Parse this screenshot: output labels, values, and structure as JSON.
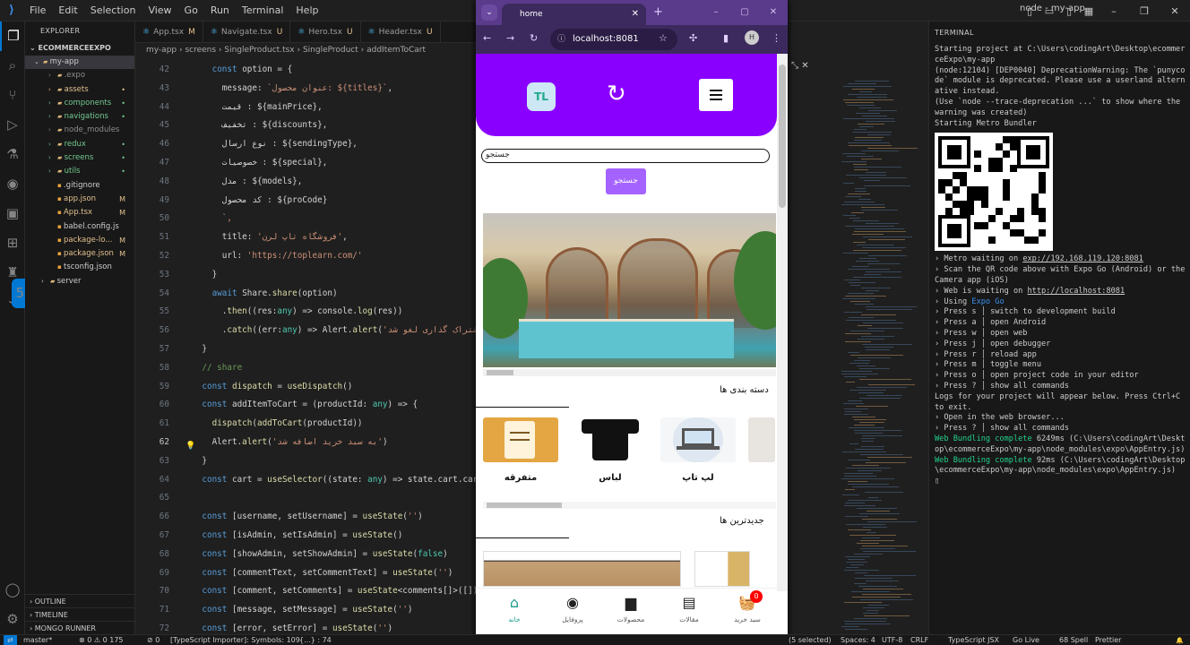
{
  "titlebar": {
    "menu": [
      "File",
      "Edit",
      "Selection",
      "View",
      "Go",
      "Run",
      "Terminal",
      "Help"
    ],
    "window_title": "node - my-app"
  },
  "explorer": {
    "header": "EXPLORER",
    "root": "ECOMMERCEEXPO",
    "items": [
      {
        "name": "my-app",
        "kind": "folder-open",
        "status": "",
        "color": "dir"
      },
      {
        "name": ".expo",
        "kind": "folder",
        "status": "",
        "color": "gr"
      },
      {
        "name": "assets",
        "kind": "folder",
        "status": "•",
        "color": "m"
      },
      {
        "name": "components",
        "kind": "folder",
        "status": "•",
        "color": "g"
      },
      {
        "name": "navigations",
        "kind": "folder",
        "status": "•",
        "color": "g"
      },
      {
        "name": "node_modules",
        "kind": "folder",
        "status": "",
        "color": "gr"
      },
      {
        "name": "redux",
        "kind": "folder",
        "status": "•",
        "color": "g"
      },
      {
        "name": "screens",
        "kind": "folder",
        "status": "•",
        "color": "g"
      },
      {
        "name": "utils",
        "kind": "folder",
        "status": "•",
        "color": "g"
      },
      {
        "name": ".gitignore",
        "kind": "file",
        "status": "",
        "color": "dir"
      },
      {
        "name": "app.json",
        "kind": "file",
        "status": "M",
        "color": "m"
      },
      {
        "name": "App.tsx",
        "kind": "file",
        "status": "M",
        "color": "m"
      },
      {
        "name": "babel.config.js",
        "kind": "file",
        "status": "",
        "color": "dir"
      },
      {
        "name": "package-lo...",
        "kind": "file",
        "status": "M",
        "color": "m"
      },
      {
        "name": "package.json",
        "kind": "file",
        "status": "M",
        "color": "m"
      },
      {
        "name": "tsconfig.json",
        "kind": "file",
        "status": "",
        "color": "dir"
      },
      {
        "name": "server",
        "kind": "folder",
        "status": "",
        "color": "dir"
      }
    ],
    "bottom": [
      "OUTLINE",
      "TIMELINE",
      "MONGO RUNNER"
    ]
  },
  "editor": {
    "tabs": [
      {
        "label": "App.tsx",
        "mod": "M"
      },
      {
        "label": "Navigate.tsx",
        "mod": "U"
      },
      {
        "label": "Hero.tsx",
        "mod": "U"
      },
      {
        "label": "Header.tsx",
        "mod": "U"
      }
    ],
    "breadcrumb": "my-app  ›  screens  ›  SingleProduct.tsx  ›  SingleProduct  ›  addItemToCart",
    "lines": [
      {
        "n": "42",
        "text": "      const option = {"
      },
      {
        "n": "43",
        "text": "        message: `عنوان محصول: ${titles}`,"
      },
      {
        "n": "44",
        "text": "        قیمت : ${mainPrice},"
      },
      {
        "n": "45",
        "text": "        تخفیف : ${discounts},"
      },
      {
        "n": "46",
        "text": "        نوع ارسال : ${sendingType},"
      },
      {
        "n": "47",
        "text": "        خصوصیات : ${special},"
      },
      {
        "n": "48",
        "text": "        مدل : ${models},"
      },
      {
        "n": "49",
        "text": "        کد محصول : ${proCode}"
      },
      {
        "n": "50",
        "text": "        `,"
      },
      {
        "n": "51",
        "text": "        title: 'فروشگاه تاپ لرن',"
      },
      {
        "n": "52",
        "text": "        url: 'https://toplearn.com/'"
      },
      {
        "n": "53",
        "text": "      }"
      },
      {
        "n": "54",
        "text": "      await Share.share(option)"
      },
      {
        "n": "55",
        "text": "        .then((res:any) => console.log(res))"
      },
      {
        "n": "56",
        "text": "        .catch((err:any) => Alert.alert('اشتراک گذاری لغو شد'))"
      },
      {
        "n": "57",
        "text": "    }"
      },
      {
        "n": "58",
        "text": "    // share"
      },
      {
        "n": "59",
        "text": "    const dispatch = useDispatch()"
      },
      {
        "n": "60",
        "text": "    const addItemToCart = (productId: any) => {"
      },
      {
        "n": "61",
        "text": "      dispatch(addToCart(productId))"
      },
      {
        "n": "62",
        "text": "      Alert.alert('به سبد خرید اضافه شد')"
      },
      {
        "n": "63",
        "text": "    }"
      },
      {
        "n": "64",
        "text": "    const cart = useSelector((state: any) => state.cart.cart)"
      },
      {
        "n": "65",
        "text": ""
      },
      {
        "n": "66",
        "text": "    const [username, setUsername] = useState('')"
      },
      {
        "n": "67",
        "text": "    const [isAdmin, setIsAdmin] = useState()"
      },
      {
        "n": "68",
        "text": "    const [showAdmin, setShowAdmin] = useState(false)"
      },
      {
        "n": "69",
        "text": "    const [commentText, setCommentText] = useState('')"
      },
      {
        "n": "70",
        "text": "    const [comment, setComments] = useState<comments[]>([])"
      },
      {
        "n": "71",
        "text": "    const [message, setMessage] = useState('')"
      },
      {
        "n": "72",
        "text": "    const [error, setError] = useState('')"
      }
    ]
  },
  "browser": {
    "tab_title": "home",
    "url": "localhost:8081",
    "profile": "H"
  },
  "app": {
    "search_placeholder": "جستجو",
    "search_button": "جستجو",
    "categories_title": "دسته بندی ها",
    "categories": [
      "لپ تاپ",
      "لباس",
      "متفرقه"
    ],
    "newest_title": "جدیدترین ها",
    "nav": [
      {
        "label": "سبد خرید",
        "icon": "basket-icon",
        "badge": "0"
      },
      {
        "label": "مقالات",
        "icon": "articles-icon"
      },
      {
        "label": "محصولات",
        "icon": "products-icon"
      },
      {
        "label": "پروفایل",
        "icon": "profile-icon"
      },
      {
        "label": "خانه",
        "icon": "home-icon"
      }
    ],
    "colors": {
      "header": "#8a00ff",
      "button": "#a463ff",
      "active": "#1a9b8a"
    }
  },
  "terminal": {
    "header": "TERMINAL",
    "lines_before_qr": [
      "Starting project at C:\\Users\\codingArt\\Desktop\\ecommerceExpo\\my-app",
      "(node:12104) [DEP0040] DeprecationWarning: The `punycode` module is deprecated. Please use a userland alternative instead.",
      "(Use `node --trace-deprecation ...` to show where the warning was created)",
      "Starting Metro Bundler"
    ],
    "metro_waiting": "› Metro waiting on ",
    "metro_url": "exp://192.168.119.120:8081",
    "scan": "› Scan the QR code above with Expo Go (Android) or the Camera app (iOS)",
    "web_waiting": "› Web is waiting on ",
    "web_url": "http://localhost:8081",
    "using": "› Using ",
    "using_val": "Expo Go",
    "commands": [
      "› Press s │ switch to development build",
      "",
      "› Press a │ open Android",
      "› Press w │ open web",
      "",
      "› Press j │ open debugger",
      "› Press r │ reload app",
      "› Press m │ toggle menu",
      "› Press o │ open project code in your editor",
      "",
      "› Press ? │ show all commands",
      "",
      "Logs for your project will appear below. Press Ctrl+C to exit.",
      "› Open in the web browser...",
      "› Press ? │ show all commands"
    ],
    "bundle1_label": "Web Bundling complete",
    "bundle1": " 6249ms (C:\\Users\\codingArt\\Desktop\\ecommerceExpo\\my-app\\node_modules\\expo\\AppEntry.js)",
    "bundle2_label": "Web Bundling complete",
    "bundle2": " 92ms (C:\\Users\\codingArt\\Desktop\\ecommerceExpo\\my-app\\node_modules\\expo\\AppEntry.js)"
  },
  "status": {
    "branch": "master*",
    "problems": "⊗ 0 ⚠ 0  175",
    "ports": "⊘ 0",
    "ts": "[TypeScript Importer]: Symbols: 109",
    "ts2": "{...} : 74",
    "selection": "(5 selected)",
    "spaces": "Spaces: 4",
    "encoding": "UTF-8",
    "eol": "CRLF",
    "lang": "TypeScript JSX",
    "golive": "Go Live",
    "spell": "68 Spell",
    "prettier": "Prettier"
  }
}
